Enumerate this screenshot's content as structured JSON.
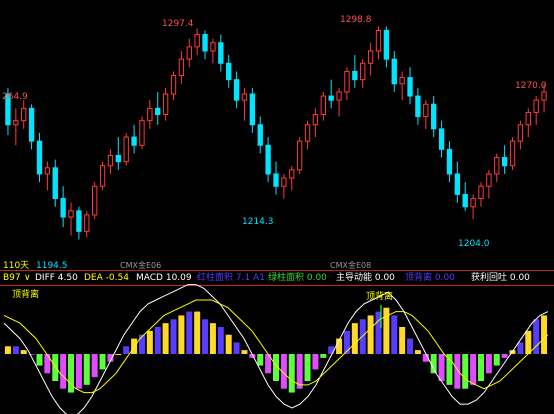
{
  "colors": {
    "background": "#000000",
    "up": "#ff3a3a",
    "down": "#00e5ff",
    "label_high": "#ff5050",
    "label_low": "#00e5ff",
    "divider": "#c81e1e",
    "diff_line": "#ffffff",
    "dea_line": "#ffff00",
    "bar_up_a": "#ffd92a",
    "bar_up_b": "#5a3cff",
    "bar_down_a": "#5cff3c",
    "bar_down_b": "#e04cff",
    "signal": "#22ff22"
  },
  "price_chart": {
    "period_label": "110天",
    "annotations": {
      "left_edge": "264.9",
      "high_1": "1297.4",
      "high_2": "1298.8",
      "right_edge": "1270.0",
      "low_1": "1194.5",
      "low_2": "1214.3",
      "low_3": "1204.0"
    },
    "contract_labels": [
      "CMX金E06",
      "CMX金E08"
    ]
  },
  "indicator_bar": {
    "menu_label": "B97",
    "menu_icon": "chevron-down",
    "diff": "DIFF 4.50",
    "dea": "DEA -0.54",
    "macd": "MACD 10.09",
    "red_area": "红柱面积 7.1 A1",
    "green_area": "绿柱面积 0.00",
    "main_force": "主导动能 0.00",
    "top_divergence_value": "顶背离 0.00",
    "profit_pullback": "获利回吐 0.00"
  },
  "macd_chart": {
    "top_divergence_label": "顶背离",
    "signal_label": "顶背离"
  },
  "chart_data": {
    "type": "candlestick",
    "ohlc": [
      [
        1265,
        1268,
        1245,
        1250
      ],
      [
        1250,
        1258,
        1240,
        1252
      ],
      [
        1252,
        1262,
        1248,
        1258
      ],
      [
        1258,
        1260,
        1238,
        1242
      ],
      [
        1242,
        1246,
        1222,
        1226
      ],
      [
        1226,
        1232,
        1218,
        1229
      ],
      [
        1229,
        1233,
        1210,
        1214
      ],
      [
        1214,
        1220,
        1200,
        1205
      ],
      [
        1205,
        1212,
        1196,
        1208
      ],
      [
        1208,
        1210,
        1194,
        1198
      ],
      [
        1198,
        1208,
        1195,
        1206
      ],
      [
        1206,
        1222,
        1204,
        1220
      ],
      [
        1220,
        1232,
        1218,
        1230
      ],
      [
        1230,
        1238,
        1226,
        1235
      ],
      [
        1235,
        1244,
        1228,
        1232
      ],
      [
        1232,
        1246,
        1230,
        1244
      ],
      [
        1244,
        1250,
        1236,
        1240
      ],
      [
        1240,
        1254,
        1238,
        1252
      ],
      [
        1252,
        1262,
        1248,
        1258
      ],
      [
        1258,
        1266,
        1250,
        1255
      ],
      [
        1255,
        1268,
        1252,
        1265
      ],
      [
        1265,
        1276,
        1262,
        1274
      ],
      [
        1274,
        1286,
        1270,
        1282
      ],
      [
        1282,
        1292,
        1278,
        1288
      ],
      [
        1288,
        1297,
        1284,
        1294
      ],
      [
        1294,
        1296,
        1282,
        1286
      ],
      [
        1286,
        1292,
        1280,
        1290
      ],
      [
        1290,
        1294,
        1276,
        1280
      ],
      [
        1280,
        1284,
        1268,
        1272
      ],
      [
        1272,
        1276,
        1258,
        1262
      ],
      [
        1262,
        1268,
        1252,
        1265
      ],
      [
        1265,
        1268,
        1246,
        1250
      ],
      [
        1250,
        1254,
        1236,
        1240
      ],
      [
        1240,
        1244,
        1222,
        1226
      ],
      [
        1226,
        1232,
        1216,
        1220
      ],
      [
        1220,
        1226,
        1214,
        1224
      ],
      [
        1224,
        1230,
        1218,
        1228
      ],
      [
        1228,
        1244,
        1226,
        1242
      ],
      [
        1242,
        1252,
        1238,
        1250
      ],
      [
        1250,
        1258,
        1244,
        1255
      ],
      [
        1255,
        1266,
        1252,
        1264
      ],
      [
        1264,
        1272,
        1258,
        1262
      ],
      [
        1262,
        1268,
        1254,
        1266
      ],
      [
        1266,
        1278,
        1262,
        1276
      ],
      [
        1276,
        1284,
        1268,
        1272
      ],
      [
        1272,
        1282,
        1268,
        1280
      ],
      [
        1280,
        1290,
        1274,
        1286
      ],
      [
        1286,
        1298,
        1282,
        1296
      ],
      [
        1296,
        1298,
        1278,
        1282
      ],
      [
        1282,
        1286,
        1266,
        1270
      ],
      [
        1270,
        1276,
        1262,
        1273
      ],
      [
        1273,
        1278,
        1260,
        1264
      ],
      [
        1264,
        1268,
        1250,
        1254
      ],
      [
        1254,
        1262,
        1248,
        1260
      ],
      [
        1260,
        1264,
        1244,
        1248
      ],
      [
        1248,
        1252,
        1234,
        1238
      ],
      [
        1238,
        1242,
        1222,
        1226
      ],
      [
        1226,
        1232,
        1212,
        1216
      ],
      [
        1216,
        1222,
        1208,
        1210
      ],
      [
        1210,
        1216,
        1204,
        1214
      ],
      [
        1214,
        1222,
        1210,
        1220
      ],
      [
        1220,
        1228,
        1214,
        1226
      ],
      [
        1226,
        1236,
        1222,
        1234
      ],
      [
        1234,
        1240,
        1226,
        1230
      ],
      [
        1230,
        1244,
        1228,
        1242
      ],
      [
        1242,
        1252,
        1238,
        1250
      ],
      [
        1250,
        1258,
        1244,
        1256
      ],
      [
        1256,
        1264,
        1250,
        1262
      ],
      [
        1262,
        1270,
        1256,
        1266
      ]
    ],
    "macd_hist": [
      2,
      2,
      1,
      0,
      -3,
      -5,
      -7,
      -9,
      -10,
      -9,
      -8,
      -6,
      -4,
      -2,
      0,
      2,
      4,
      5,
      6,
      7,
      8,
      9,
      10,
      11,
      11,
      9,
      8,
      7,
      5,
      3,
      1,
      -1,
      -3,
      -5,
      -7,
      -9,
      -10,
      -9,
      -7,
      -4,
      -1,
      2,
      4,
      6,
      8,
      9,
      10,
      11,
      12,
      10,
      7,
      4,
      1,
      -2,
      -5,
      -7,
      -8,
      -9,
      -9,
      -8,
      -7,
      -5,
      -3,
      -1,
      1,
      3,
      6,
      9,
      10
    ],
    "diff": [
      8,
      6,
      4,
      1,
      -3,
      -7,
      -11,
      -14,
      -16,
      -16,
      -14,
      -11,
      -7,
      -3,
      1,
      5,
      8,
      11,
      13,
      14,
      15,
      16,
      17,
      18,
      18,
      17,
      15,
      13,
      10,
      7,
      4,
      0,
      -4,
      -8,
      -11,
      -13,
      -14,
      -13,
      -11,
      -8,
      -4,
      0,
      4,
      8,
      11,
      13,
      14,
      15,
      16,
      14,
      11,
      7,
      3,
      -1,
      -5,
      -8,
      -11,
      -13,
      -13,
      -12,
      -10,
      -7,
      -4,
      -1,
      2,
      5,
      8,
      10,
      11
    ],
    "dea": [
      10,
      9,
      8,
      6,
      4,
      1,
      -2,
      -5,
      -7,
      -9,
      -10,
      -10,
      -9,
      -7,
      -5,
      -2,
      1,
      4,
      6,
      8,
      10,
      11,
      12,
      13,
      14,
      14,
      14,
      13,
      12,
      10,
      8,
      6,
      3,
      0,
      -3,
      -5,
      -7,
      -8,
      -8,
      -7,
      -5,
      -3,
      -1,
      1,
      3,
      5,
      7,
      9,
      10,
      11,
      11,
      10,
      8,
      6,
      3,
      0,
      -2,
      -5,
      -7,
      -8,
      -9,
      -8,
      -7,
      -5,
      -3,
      -1,
      1,
      3,
      5
    ],
    "price_range": [
      1185,
      1305
    ],
    "macd_range": [
      -14,
      14
    ]
  }
}
